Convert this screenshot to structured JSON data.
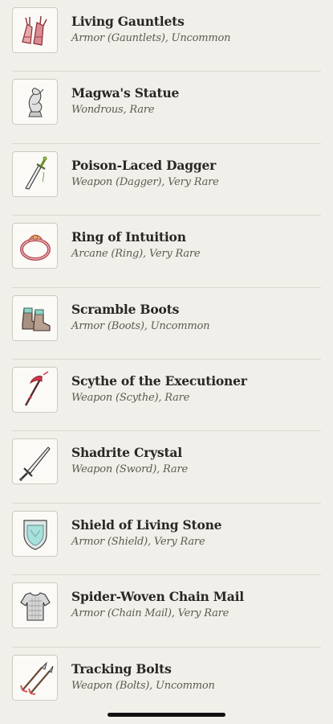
{
  "items": [
    {
      "name": "Living Gauntlets",
      "meta": "Armor (Gauntlets), Uncommon",
      "icon": "gauntlets-icon"
    },
    {
      "name": "Magwa's Statue",
      "meta": "Wondrous, Rare",
      "icon": "statue-icon"
    },
    {
      "name": "Poison-Laced Dagger",
      "meta": "Weapon (Dagger), Very Rare",
      "icon": "dagger-icon"
    },
    {
      "name": "Ring of Intuition",
      "meta": "Arcane (Ring), Very Rare",
      "icon": "ring-icon"
    },
    {
      "name": "Scramble Boots",
      "meta": "Armor (Boots), Uncommon",
      "icon": "boots-icon"
    },
    {
      "name": "Scythe of the Executioner",
      "meta": "Weapon (Scythe), Rare",
      "icon": "scythe-icon"
    },
    {
      "name": "Shadrite Crystal",
      "meta": "Weapon (Sword), Rare",
      "icon": "sword-icon"
    },
    {
      "name": "Shield of Living Stone",
      "meta": "Armor (Shield), Very Rare",
      "icon": "shield-icon"
    },
    {
      "name": "Spider-Woven Chain Mail",
      "meta": "Armor (Chain Mail), Very Rare",
      "icon": "chain-mail-icon"
    },
    {
      "name": "Tracking Bolts",
      "meta": "Weapon (Bolts), Uncommon",
      "icon": "bolts-icon"
    }
  ]
}
